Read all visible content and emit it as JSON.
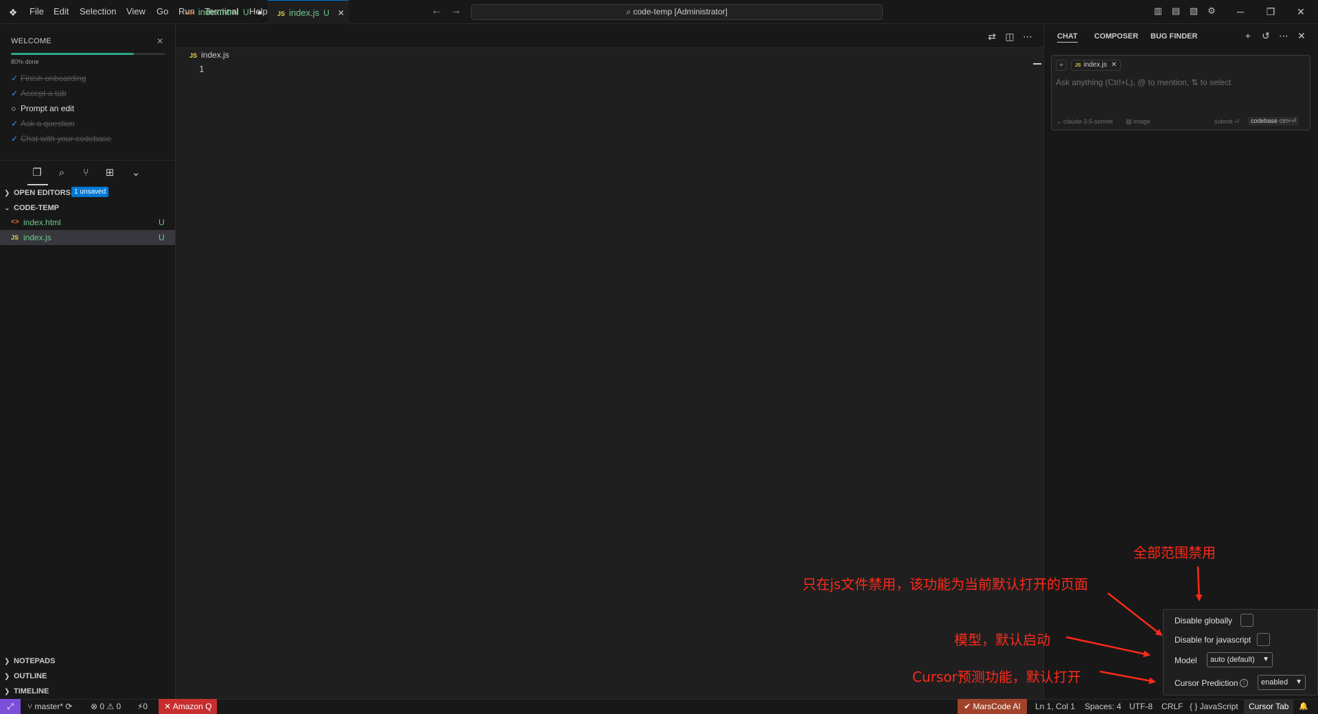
{
  "titlebar": {
    "menus": [
      "File",
      "Edit",
      "Selection",
      "View",
      "Go",
      "Run",
      "Terminal",
      "Help"
    ],
    "command_center": "code-temp [Administrator]",
    "search_glyph": "⌕"
  },
  "welcome": {
    "title": "WELCOME",
    "progress_label": "80% done",
    "progress_fraction": 0.8,
    "todos": [
      {
        "label": "Finish onboarding",
        "done": true
      },
      {
        "label": "Accept a tab",
        "done": true
      },
      {
        "label": "Prompt an edit",
        "done": false
      },
      {
        "label": "Ask a question",
        "done": true
      },
      {
        "label": "Chat with your codebase",
        "done": true
      }
    ]
  },
  "explorer": {
    "open_editors": "OPEN EDITORS",
    "unsaved_badge": "1 unsaved",
    "folder": "CODE-TEMP",
    "files": [
      {
        "icon": "<>",
        "name": "index.html",
        "status": "U"
      },
      {
        "icon": "JS",
        "name": "index.js",
        "status": "U"
      }
    ],
    "bottom_sections": [
      "NOTEPADS",
      "OUTLINE",
      "TIMELINE"
    ]
  },
  "editor": {
    "tabs": [
      {
        "icon": "<>",
        "name": "index.html",
        "status": "U",
        "dirty_mark": "●"
      },
      {
        "icon": "JS",
        "name": "index.js",
        "status": "U",
        "close_mark": "✕"
      }
    ],
    "breadcrumb_icon": "JS",
    "breadcrumb": "index.js",
    "line_number": "1"
  },
  "chat": {
    "tabs": [
      "CHAT",
      "COMPOSER",
      "BUG FINDER"
    ],
    "chip_icon": "JS",
    "chip_label": "index.js",
    "placeholder": "Ask anything (Ctrl+L), @ to mention, ⇅ to select",
    "model": "⌄ claude-3.5-sonnet",
    "image_label": "▨ image",
    "submit_label": "submit ⏎",
    "codebase_label": "codebase",
    "codebase_kb": "ctrl+⏎"
  },
  "popup": {
    "disable_globally": "Disable globally",
    "disable_for_js": "Disable for javascript",
    "model_label": "Model",
    "model_value": "auto (default)",
    "prediction_label": "Cursor Prediction",
    "prediction_value": "enabled",
    "info_glyph": "i",
    "dropdown_glyph": "▼"
  },
  "annotations": {
    "global": "全部范围禁用",
    "js_only": "只在js文件禁用，该功能为当前默认打开的页面",
    "model": "模型，默认启动",
    "prediction": "Cursor预测功能，默认打开"
  },
  "statusbar": {
    "remote": "⤢",
    "branch": "master*",
    "errors": "⊗ 0 ⚠ 0",
    "ports": "⚡0",
    "amazon_q": "✕ Amazon Q",
    "marscode": "✔ MarsCode AI",
    "position": "Ln 1, Col 1",
    "spaces": "Spaces: 4",
    "encoding": "UTF-8",
    "eol": "CRLF",
    "language": "{ } JavaScript",
    "cursor_tab": "Cursor Tab",
    "bell": "🔔"
  },
  "colors": {
    "accent": "#0078d4",
    "untracked": "#73c991",
    "annotation": "#ff2a1a",
    "progress": "#2ea88a"
  }
}
